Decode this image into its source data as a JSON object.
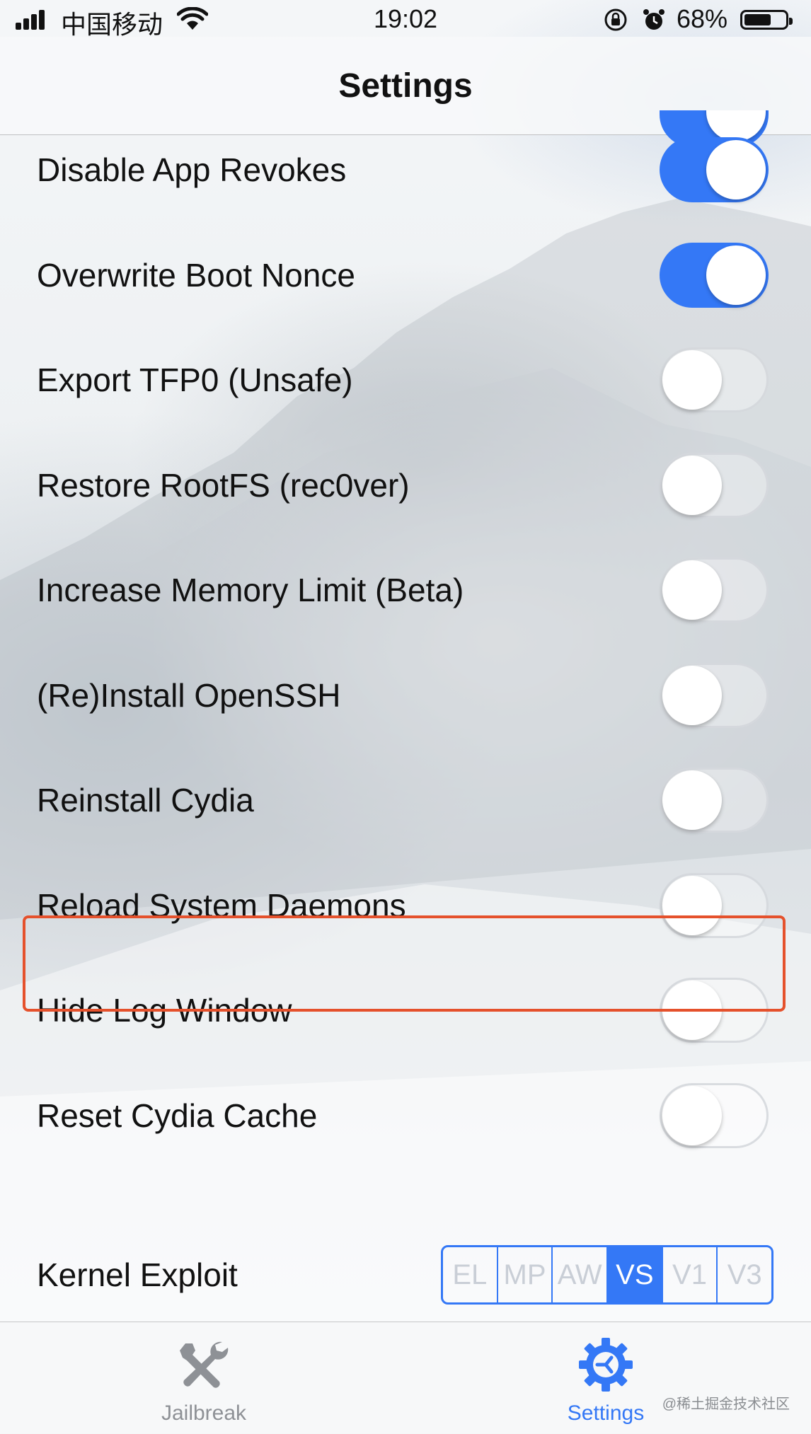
{
  "status_bar": {
    "carrier": "中国移动",
    "time": "19:02",
    "battery_percent": "68%",
    "battery_level": 0.68
  },
  "nav": {
    "title": "Settings"
  },
  "settings": [
    {
      "label": "Disable App Revokes",
      "on": true
    },
    {
      "label": "Overwrite Boot Nonce",
      "on": true
    },
    {
      "label": "Export TFP0 (Unsafe)",
      "on": false
    },
    {
      "label": "Restore RootFS (rec0ver)",
      "on": false
    },
    {
      "label": "Increase Memory Limit (Beta)",
      "on": false
    },
    {
      "label": "(Re)Install OpenSSH",
      "on": false
    },
    {
      "label": "Reinstall Cydia",
      "on": false
    },
    {
      "label": "Reload System Daemons",
      "on": false
    },
    {
      "label": "Hide Log Window",
      "on": false
    },
    {
      "label": "Reset Cydia Cache",
      "on": false
    }
  ],
  "kernel_exploit": {
    "label": "Kernel Exploit",
    "options": [
      "EL",
      "MP",
      "AW",
      "VS",
      "V1",
      "V3"
    ],
    "selected": "VS"
  },
  "tabs": [
    {
      "label": "Jailbreak",
      "icon": "wrench-screwdriver-icon",
      "active": false
    },
    {
      "label": "Settings",
      "icon": "gear-icon",
      "active": true
    }
  ],
  "colors": {
    "accent": "#3478f6",
    "highlight": "#e5512c",
    "inactive_tab": "#8e9196"
  },
  "watermark": "@稀土掘金技术社区"
}
